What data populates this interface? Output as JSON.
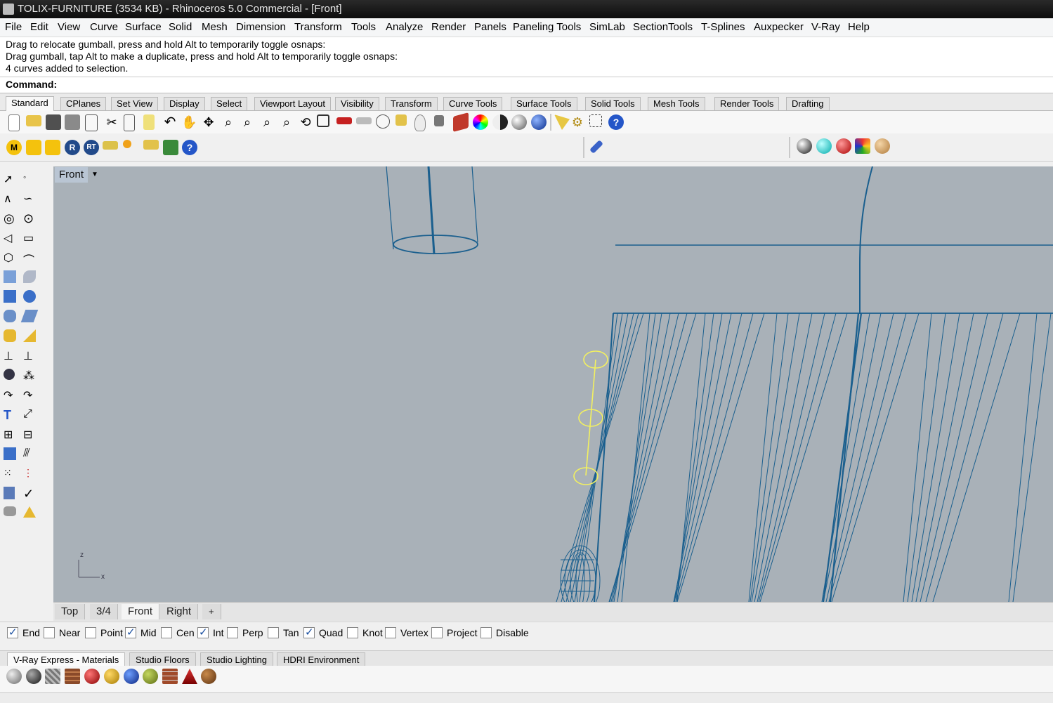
{
  "window": {
    "title": "TOLIX-FURNITURE (3534 KB) - Rhinoceros 5.0 Commercial - [Front]"
  },
  "menu": [
    "File",
    "Edit",
    "View",
    "Curve",
    "Surface",
    "Solid",
    "Mesh",
    "Dimension",
    "Transform",
    "Tools",
    "Analyze",
    "Render",
    "Panels",
    "Paneling Tools",
    "SimLab",
    "SectionTools",
    "T-Splines",
    "Auxpecker",
    "V-Ray",
    "Help"
  ],
  "history": [
    "Drag to relocate gumball, press and hold Alt to temporarily toggle osnaps:",
    "Drag gumball, tap Alt to make a duplicate, press and hold Alt to temporarily toggle osnaps:",
    "4 curves added to selection."
  ],
  "command": {
    "label": "Command:",
    "value": ""
  },
  "toolbar_tabs": [
    "Standard",
    "CPlanes",
    "Set View",
    "Display",
    "Select",
    "Viewport Layout",
    "Visibility",
    "Transform",
    "Curve Tools",
    "Surface Tools",
    "Solid Tools",
    "Mesh Tools",
    "Render Tools",
    "Drafting"
  ],
  "viewport": {
    "name": "Front",
    "axis_z": "z",
    "axis_x": "x"
  },
  "viewport_tabs": [
    "Top",
    "3/4",
    "Front",
    "Right",
    "+"
  ],
  "osnaps": [
    {
      "label": "End",
      "checked": true
    },
    {
      "label": "Near",
      "checked": false
    },
    {
      "label": "Point",
      "checked": false
    },
    {
      "label": "Mid",
      "checked": true
    },
    {
      "label": "Cen",
      "checked": false
    },
    {
      "label": "Int",
      "checked": true
    },
    {
      "label": "Perp",
      "checked": false
    },
    {
      "label": "Tan",
      "checked": false
    },
    {
      "label": "Quad",
      "checked": true
    },
    {
      "label": "Knot",
      "checked": false
    },
    {
      "label": "Vertex",
      "checked": false
    },
    {
      "label": "Project",
      "checked": false
    },
    {
      "label": "Disable",
      "checked": false
    }
  ],
  "bottom_tabs": [
    "V-Ray Express - Materials",
    "Studio Floors",
    "Studio Lighting",
    "HDRI Environment"
  ],
  "colors": {
    "wire": "#1a5f8e",
    "selected": "#f2f060",
    "viewport_bg": "#a9b1b8"
  }
}
